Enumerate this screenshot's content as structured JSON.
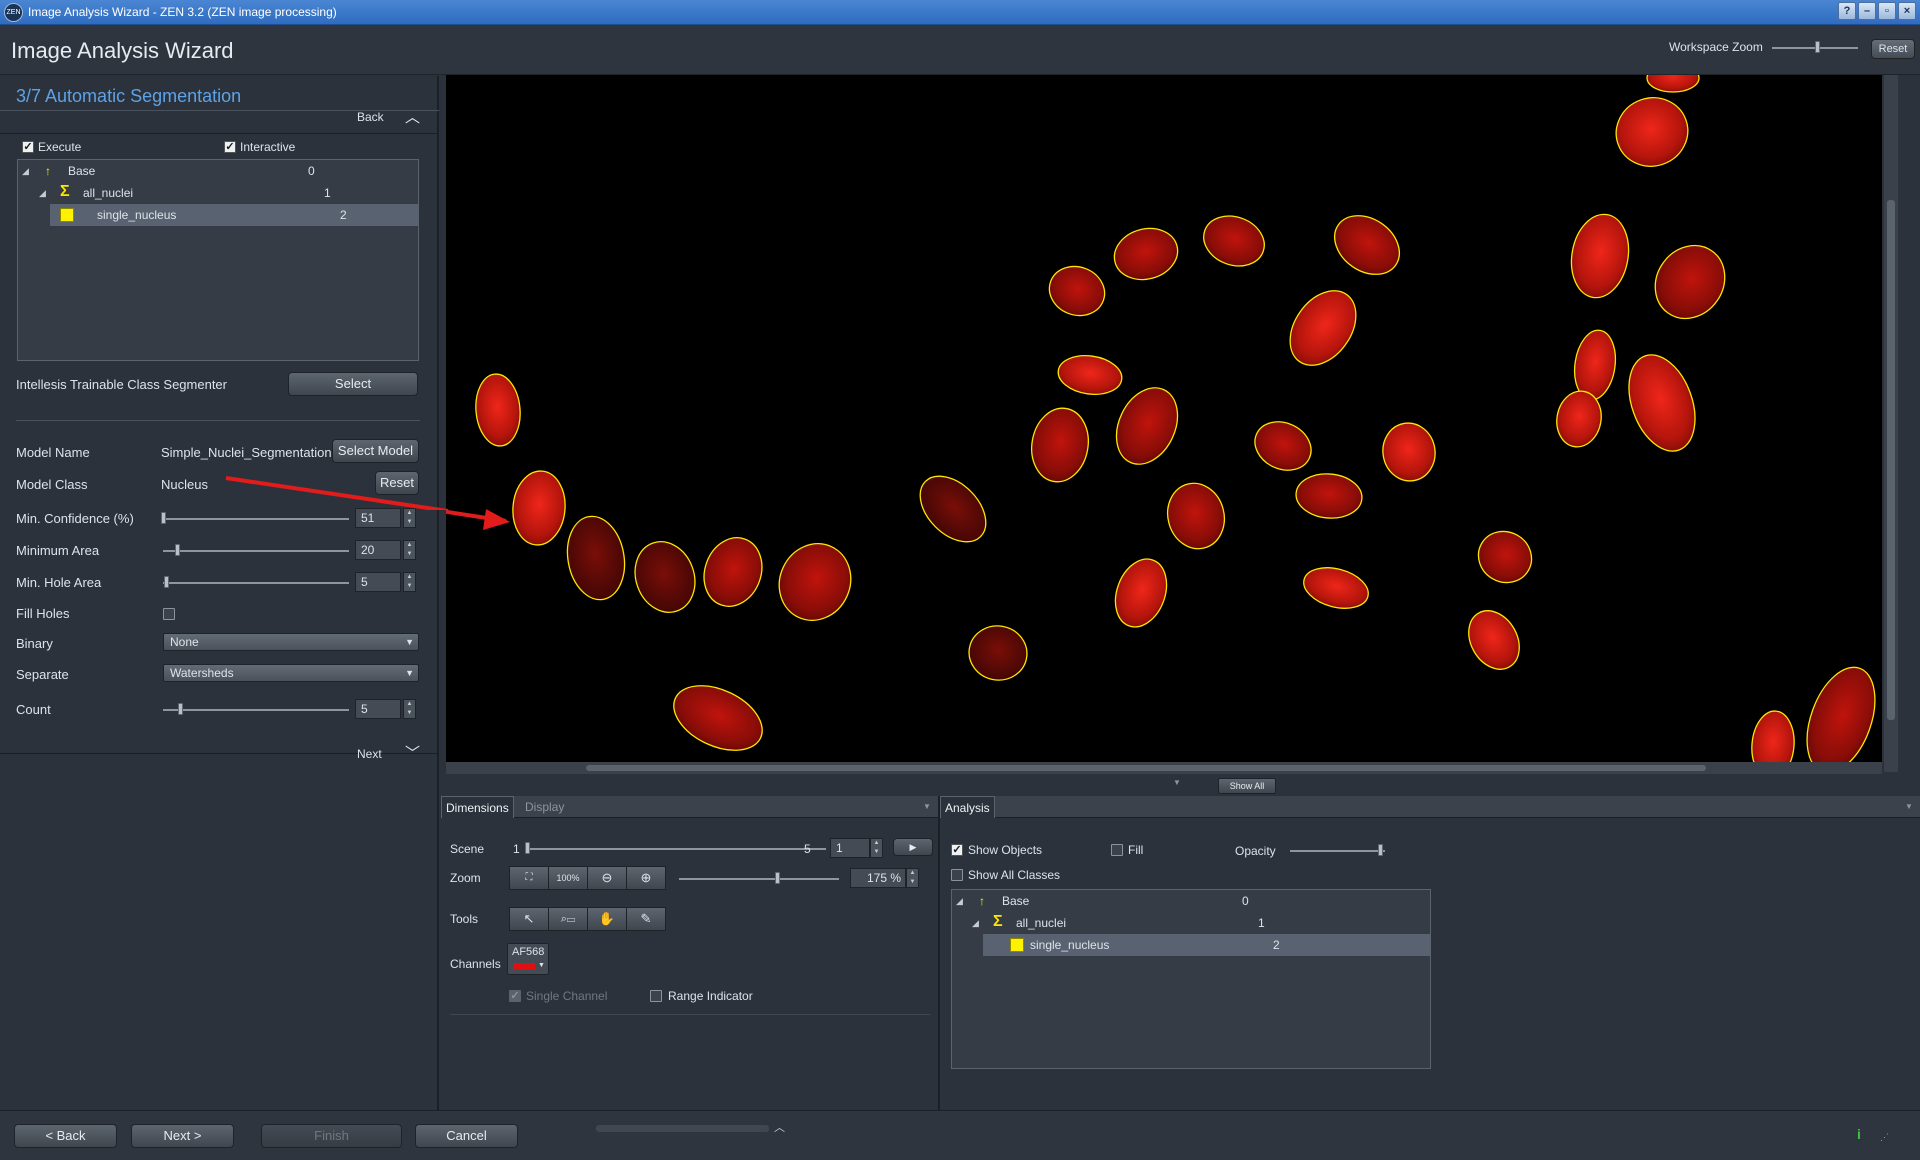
{
  "window": {
    "logo_text": "ZEN",
    "title": "Image Analysis Wizard - ZEN 3.2 (ZEN image processing)",
    "buttons": [
      "?",
      "–",
      "▫",
      "×"
    ]
  },
  "header": {
    "title": "Image Analysis Wizard",
    "workspace_zoom_label": "Workspace Zoom",
    "reset_label": "Reset"
  },
  "left": {
    "step_title": "3/7 Automatic Segmentation",
    "back_label": "Back",
    "next_label": "Next",
    "execute_label": "Execute",
    "interactive_label": "Interactive",
    "classes": [
      {
        "name": "Base",
        "id": "0"
      },
      {
        "name": "all_nuclei",
        "id": "1"
      },
      {
        "name": "single_nucleus",
        "id": "2"
      }
    ],
    "segmenter_label": "Intellesis Trainable Class Segmenter",
    "select_label": "Select",
    "model_name_label": "Model Name",
    "model_name_value": "Simple_Nuclei_Segmentation",
    "select_model_label": "Select Model",
    "model_class_label": "Model Class",
    "model_class_value": "Nucleus",
    "reset_label": "Reset",
    "min_confidence_label": "Min. Confidence (%)",
    "min_confidence_value": "51",
    "minimum_area_label": "Minimum Area",
    "minimum_area_value": "20",
    "min_hole_area_label": "Min. Hole Area",
    "min_hole_area_value": "5",
    "fill_holes_label": "Fill Holes",
    "binary_label": "Binary",
    "binary_value": "None",
    "separate_label": "Separate",
    "separate_value": "Watersheds",
    "count_label": "Count",
    "count_value": "5"
  },
  "viewer": {
    "show_all_label": "Show All"
  },
  "dimensions": {
    "tab_dimensions": "Dimensions",
    "tab_display": "Display",
    "scene_label": "Scene",
    "scene_min": "1",
    "scene_max": "5",
    "scene_value": "1",
    "zoom_label": "Zoom",
    "zoom_100_label": "100%",
    "zoom_value": "175 %",
    "tools_label": "Tools",
    "channels_label": "Channels",
    "channel_name": "AF568",
    "channel_color": "#e01010",
    "single_channel_label": "Single Channel",
    "range_indicator_label": "Range Indicator"
  },
  "analysis": {
    "tab_label": "Analysis",
    "show_objects_label": "Show Objects",
    "fill_label": "Fill",
    "opacity_label": "Opacity",
    "show_all_classes_label": "Show All Classes",
    "classes": [
      {
        "name": "Base",
        "id": "0"
      },
      {
        "name": "all_nuclei",
        "id": "1"
      },
      {
        "name": "single_nucleus",
        "id": "2"
      }
    ]
  },
  "footer": {
    "back_label": "< Back",
    "next_label": "Next >",
    "finish_label": "Finish",
    "cancel_label": "Cancel",
    "info_icon_label": "i"
  },
  "colors": {
    "accent": "#5ea2e8",
    "nucleus_outline": "#ffe600",
    "class_yellow": "#fff200",
    "arrow_red": "#e21b1b"
  }
}
